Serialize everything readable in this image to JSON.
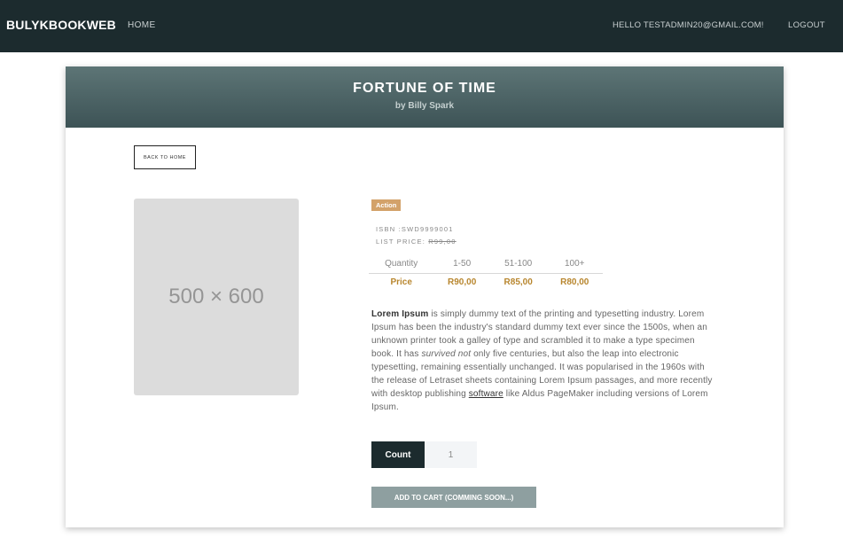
{
  "nav": {
    "brand": "BULYKBOOKWEB",
    "home": "HOME",
    "hello": "HELLO TESTADMIN20@GMAIL.COM!",
    "logout": "LOGOUT"
  },
  "book": {
    "title": "FORTUNE OF TIME",
    "author": "by Billy Spark",
    "back_label": "BACK TO HOME",
    "image_placeholder": "500 × 600",
    "category": "Action",
    "isbn_label": "ISBN :",
    "isbn": "SWD9999001",
    "list_price_label": "LIST PRICE: ",
    "list_price": "R99,00",
    "quantity_header": "Quantity",
    "price_header": "Price",
    "tiers": [
      {
        "range": "1-50",
        "price": "R90,00"
      },
      {
        "range": "51-100",
        "price": "R85,00"
      },
      {
        "range": "100+",
        "price": "R80,00"
      }
    ],
    "description": {
      "lead": "Lorem Ipsum",
      "part1": " is simply dummy text of the printing and typesetting industry. Lorem Ipsum has been the industry's standard dummy text ever since the 1500s, when an unknown printer took a galley of type and scrambled it to make a type specimen book. It has ",
      "italic": "survived not",
      "part2": " only five centuries, but also the leap into electronic typesetting, remaining essentially unchanged. It was popularised in the 1960s with the release of Letraset sheets containing Lorem Ipsum passages, and more recently with desktop publishing ",
      "link": "software",
      "part3": " like Aldus PageMaker including versions of Lorem Ipsum."
    },
    "count_label": "Count",
    "count_value": "1",
    "add_cart_label": "ADD TO CART (COMMING SOON...)"
  },
  "colors": {
    "navbar": "#1c2b2e",
    "header_top": "#5d7576",
    "header_bottom": "#3d5356",
    "badge": "#d3a26a",
    "price": "#b8862e",
    "add_cart": "#8e9fa0"
  }
}
